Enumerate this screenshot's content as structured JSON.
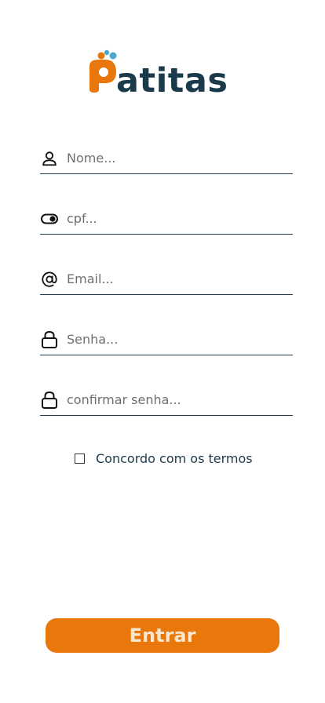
{
  "brand": {
    "name": "Patitas",
    "letters": [
      "P",
      "a",
      "t",
      "i",
      "t",
      "a",
      "s"
    ],
    "colors": {
      "orange": "#e8780c",
      "navy": "#1b3b4d",
      "light_blue": "#4fa7c9"
    }
  },
  "form": {
    "fields": [
      {
        "id": "name",
        "icon": "user-icon",
        "placeholder": "Nome..."
      },
      {
        "id": "cpf",
        "icon": "id-card-toggle-icon",
        "placeholder": "cpf..."
      },
      {
        "id": "email",
        "icon": "at-sign-icon",
        "placeholder": "Email..."
      },
      {
        "id": "password",
        "icon": "lock-icon",
        "placeholder": "Senha..."
      },
      {
        "id": "confirm_password",
        "icon": "lock-icon",
        "placeholder": "confirmar senha..."
      }
    ],
    "terms_label": "Concordo com os termos",
    "terms_checked": false,
    "submit_label": "Entrar"
  },
  "colors": {
    "underline": "#1b3b4d",
    "button_bg": "#e8780c",
    "button_text": "#fde6cf",
    "placeholder": "#6f6f6f"
  }
}
